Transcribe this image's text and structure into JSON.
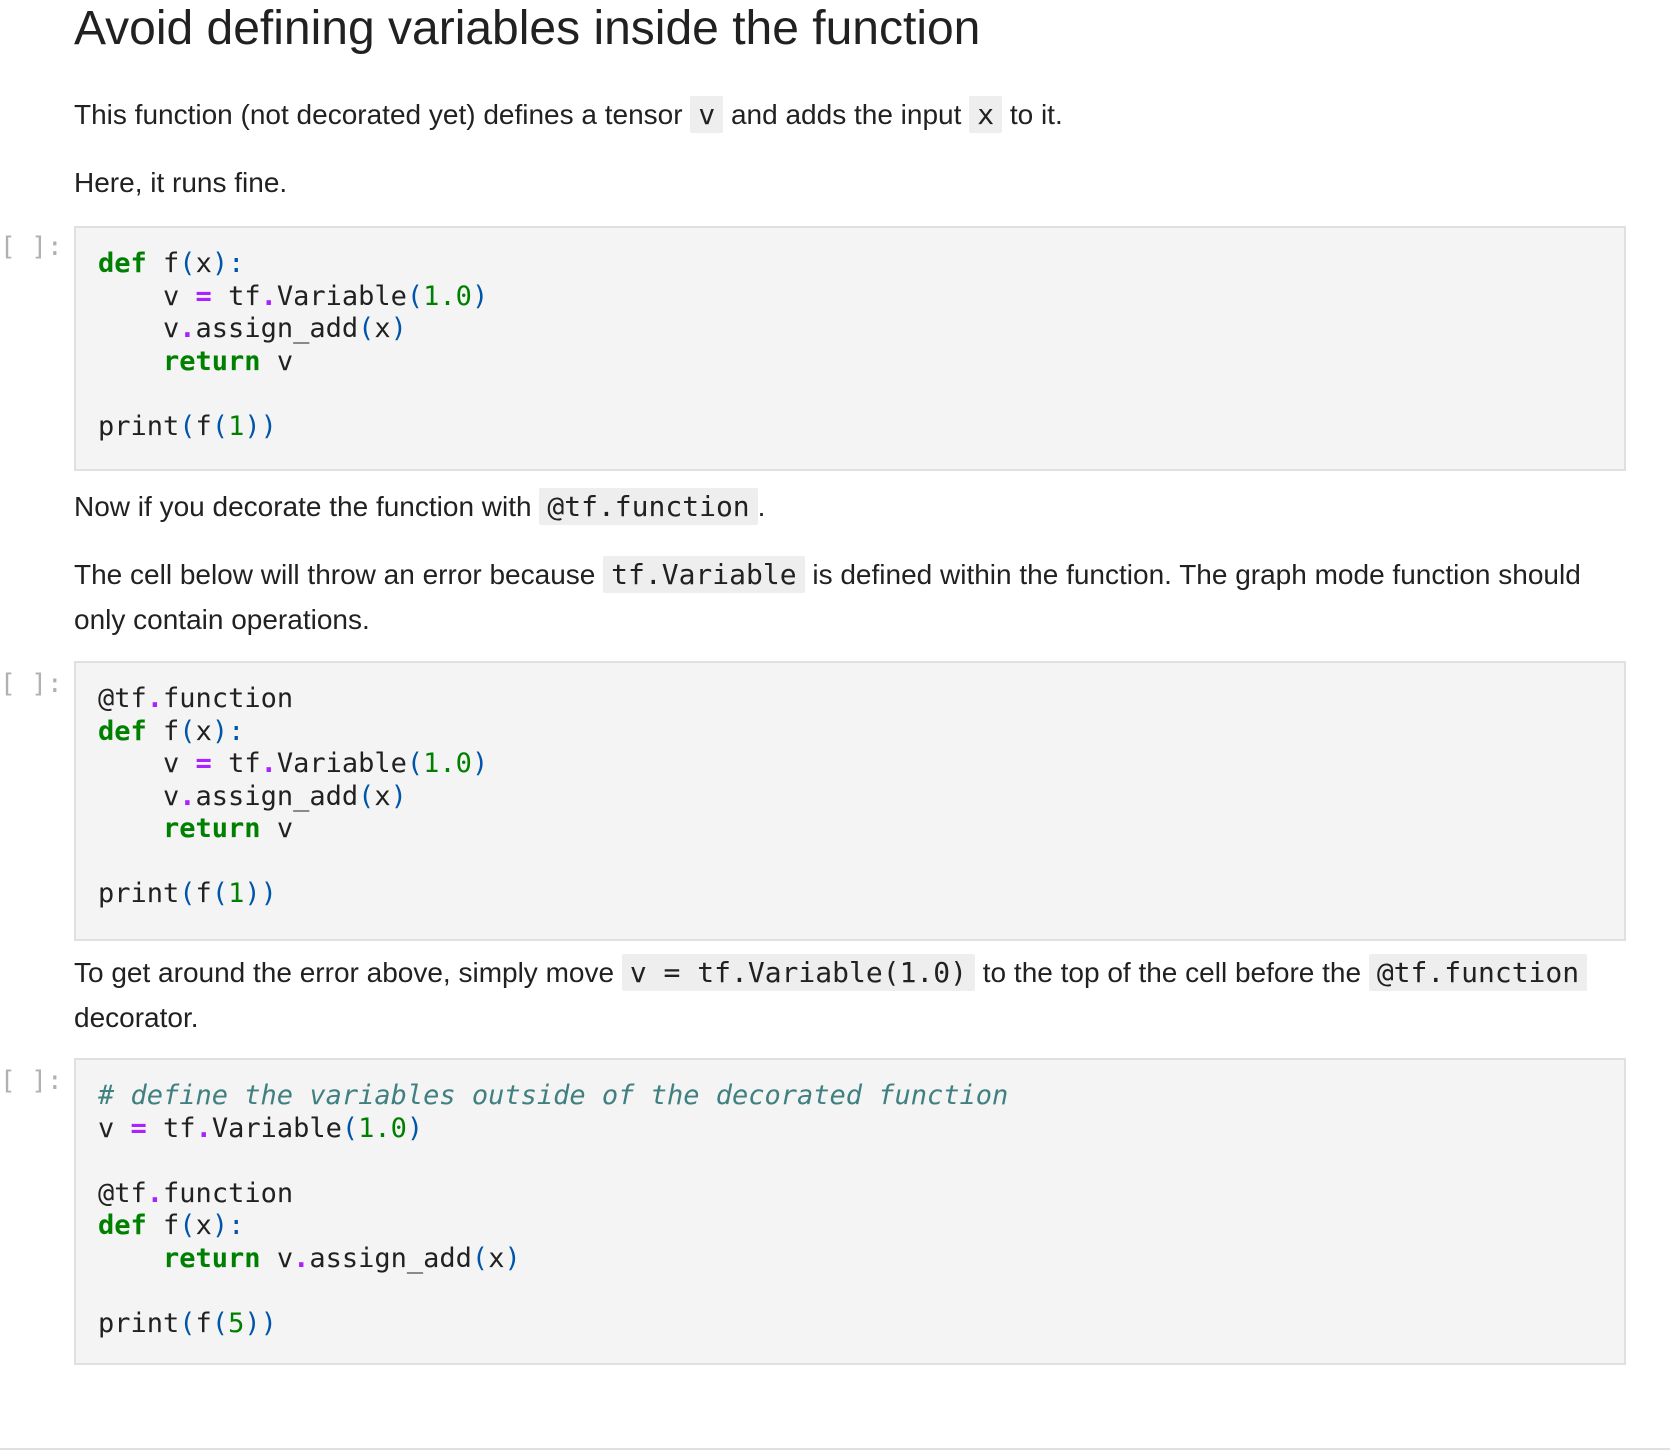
{
  "heading": "Avoid defining variables inside the function",
  "p1": {
    "t1": "This function (not decorated yet) defines a tensor ",
    "c1": "v",
    "t2": " and adds the input ",
    "c2": "x",
    "t3": " to it."
  },
  "p2": "Here, it runs fine.",
  "p3": {
    "t1": "Now if you decorate the function with ",
    "c1": "@tf.function",
    "t2": "."
  },
  "p4": {
    "t1": "The cell below will throw an error because ",
    "c1": "tf.Variable",
    "t2": " is defined within the function. The graph mode function should only contain operations."
  },
  "p5": {
    "t1": "To get around the error above, simply move ",
    "c1": "v = tf.Variable(1.0)",
    "t2": " to the top of the cell before the ",
    "c2": "@tf.function",
    "t3": " decorator."
  },
  "prompts": [
    "[ ]:",
    "[ ]:",
    "[ ]:"
  ],
  "cells": [
    {
      "lines": [
        "def f(x):",
        "    v = tf.Variable(1.0)",
        "    v.assign_add(x)",
        "    return v",
        "",
        "print(f(1))"
      ]
    },
    {
      "lines": [
        "@tf.function",
        "def f(x):",
        "    v = tf.Variable(1.0)",
        "    v.assign_add(x)",
        "    return v",
        "",
        "print(f(1))"
      ]
    },
    {
      "lines": [
        "# define the variables outside of the decorated function",
        "v = tf.Variable(1.0)",
        "",
        "@tf.function",
        "def f(x):",
        "    return v.assign_add(x)",
        "",
        "print(f(5))"
      ]
    }
  ]
}
